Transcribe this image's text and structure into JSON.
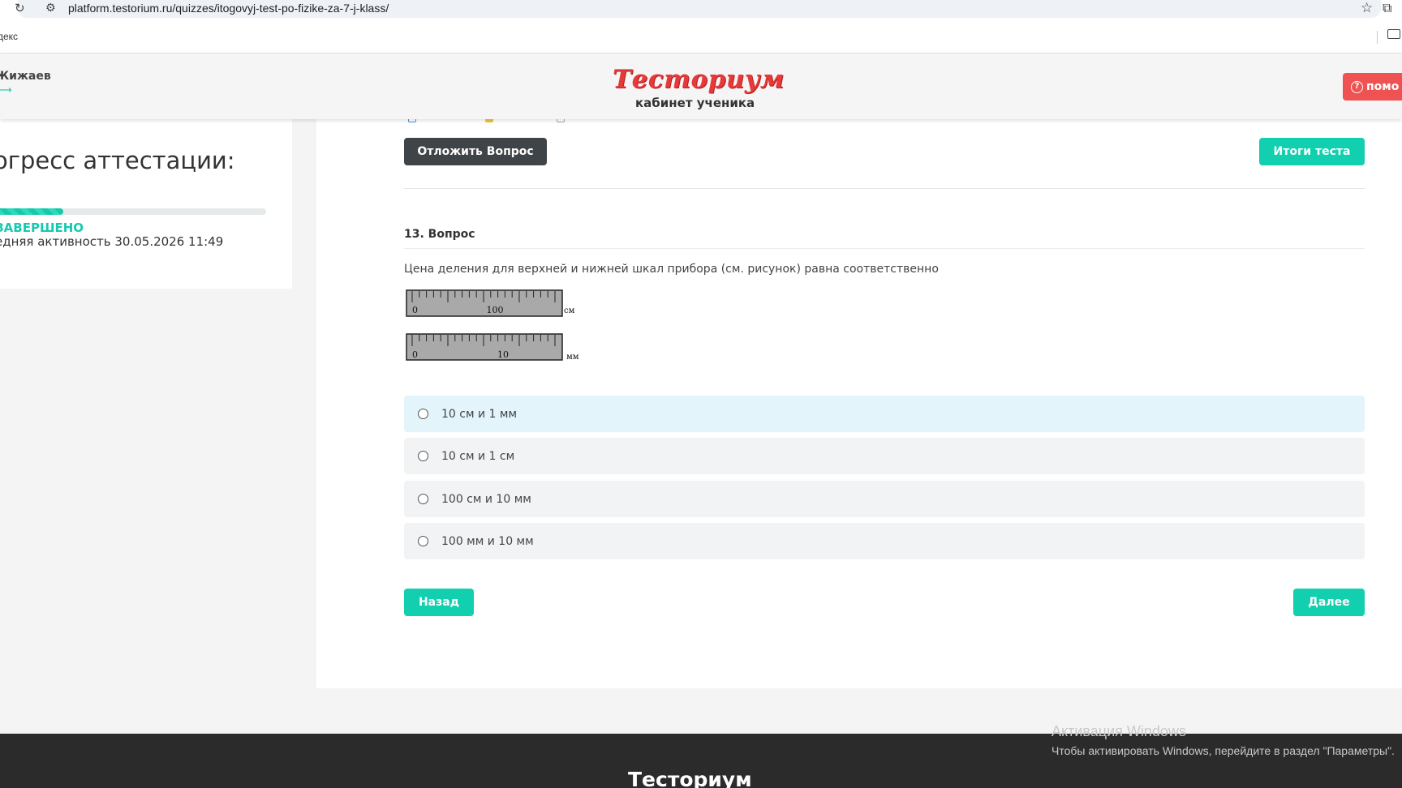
{
  "browser": {
    "url": "platform.testorium.ru/quizzes/itogovyj-test-po-fizike-za-7-j-klass/",
    "bookmark": "декс"
  },
  "header": {
    "user_name": "Жижаев",
    "logo": "Тесториум",
    "logo_subtitle": "кабинет ученика",
    "help_label": "помо"
  },
  "sidebar": {
    "progress_title": "огресс аттестации:",
    "progress_percent": 26,
    "status": "ЗАВЕРШЕНО",
    "last_activity": "едняя активность 30.05.2026 11:49"
  },
  "main": {
    "postpone_label": "Отложить Вопрос",
    "results_label": "Итоги теста",
    "question_title": "13. Вопрос",
    "question_text": "Цена деления для верхней и нижней шкал прибора (см. рисунок) равна соответственно",
    "figure": {
      "top_scale": {
        "start": "0",
        "mark": "100",
        "unit": "см"
      },
      "bottom_scale": {
        "start": "0",
        "mark": "10",
        "unit": "мм"
      }
    },
    "answers": [
      {
        "label": "10 см и 1 мм",
        "selected": true
      },
      {
        "label": "10 см и 1 см",
        "selected": false
      },
      {
        "label": "100 см и 10 мм",
        "selected": false
      },
      {
        "label": "100 мм и 10 мм",
        "selected": false
      }
    ],
    "back_label": "Назад",
    "next_label": "Далее"
  },
  "footer": {
    "logo": "Тесториум"
  },
  "watermark": {
    "title": "Активация Windows",
    "subtitle": "Чтобы активировать Windows, перейдите в раздел \"Параметры\"."
  },
  "colors": {
    "accent": "#12cfb0",
    "dark_button": "#3f4448",
    "help_button": "#ee5252",
    "logo_red": "#e63a3a",
    "selected_answer": "#e3f4fb"
  }
}
